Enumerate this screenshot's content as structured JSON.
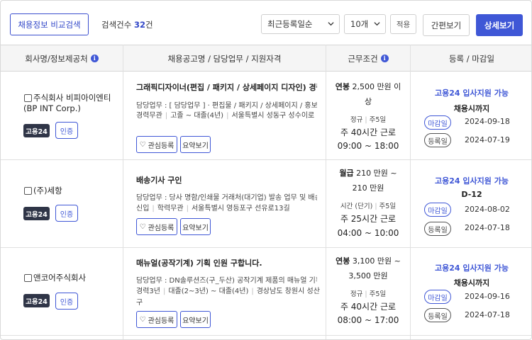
{
  "toolbar": {
    "compare_button": "채용정보 비교검색",
    "count_label": "검색건수",
    "count_value": "32",
    "count_unit": "건",
    "sort_select": "최근등록일순",
    "page_size_select": "10개",
    "apply_button": "적용",
    "simple_view_button": "간편보기",
    "detail_view_button": "상세보기",
    "accent_color": "#3f57d6"
  },
  "table": {
    "headers": {
      "company": "회사명/정보제공처",
      "job": "채용공고명 / 담당업무 / 지원자격",
      "conditions": "근무조건",
      "dates": "등록 / 마감일"
    },
    "rows": [
      {
        "company": "주식회사 비피아이엔티(BP INT Corp.)",
        "tag": "고용24",
        "cert": "인증",
        "title": "그래픽디자이너(편집 / 패키지 / 상세페이지 디자인) 경력직 모집",
        "duty": "담당업무 : [ 담당업무 ] · 편집물 / 패키지 / 상세페이지 / 홍보물 디자인",
        "meta1": "경력무관",
        "meta2": "고졸 ~ 대졸(4년)",
        "meta3": "서울특별시 성동구 성수이로",
        "like": "관심등록",
        "summary": "요약보기",
        "pay_type": "연봉",
        "pay": "2,500 만원 이상",
        "emp_type": "정규",
        "week": "주5일",
        "hours": "주 40시간 근로",
        "time": "09:00 ~ 18:00",
        "support": "고용24 입사지원 가능",
        "deadline": "채용시까지",
        "deadline_label": "마감일",
        "deadline_date": "2024-09-18",
        "reg_label": "등록일",
        "reg_date": "2024-07-19"
      },
      {
        "company": "(주)세항",
        "tag": "고용24",
        "cert": "인증",
        "title": "배송기사 구인",
        "duty": "담당업무 : 당사 명함/인쇄물 거래처(대기업) 발송 업무 및 배송",
        "meta1": "신입",
        "meta2": "학력무관",
        "meta3": "서울특별시 영등포구 선유로13길",
        "like": "관심등록",
        "summary": "요약보기",
        "pay_type": "월급",
        "pay": "210 만원 ~ 210 만원",
        "emp_type": "시간 (단기)",
        "week": "주5일",
        "hours": "주 25시간 근로",
        "time": "04:00 ~ 10:00",
        "support": "고용24 입사지원 가능",
        "deadline": "D-12",
        "deadline_label": "마감일",
        "deadline_date": "2024-08-02",
        "reg_label": "등록일",
        "reg_date": "2024-07-18"
      },
      {
        "company": "앤코어주식회사",
        "tag": "고용24",
        "cert": "인증",
        "title": "매뉴얼(공작기계) 기획 인원 구합니다.",
        "duty": "담당업무 : DN솔루션즈(구_두산) 공작기계 제품의 매뉴얼 기획",
        "meta1": "경력3년",
        "meta2": "대졸(2~3년) ~ 대졸(4년)",
        "meta3": "경상남도 창원시 성산구",
        "like": "관심등록",
        "summary": "요약보기",
        "pay_type": "연봉",
        "pay": "3,100 만원 ~ 3,500 만원",
        "emp_type": "정규",
        "week": "주5일",
        "hours": "주 40시간 근로",
        "time": "08:00 ~ 17:00",
        "support": "고용24 입사지원 가능",
        "deadline": "채용시까지",
        "deadline_label": "마감일",
        "deadline_date": "2024-09-16",
        "reg_label": "등록일",
        "reg_date": "2024-07-18"
      }
    ]
  }
}
